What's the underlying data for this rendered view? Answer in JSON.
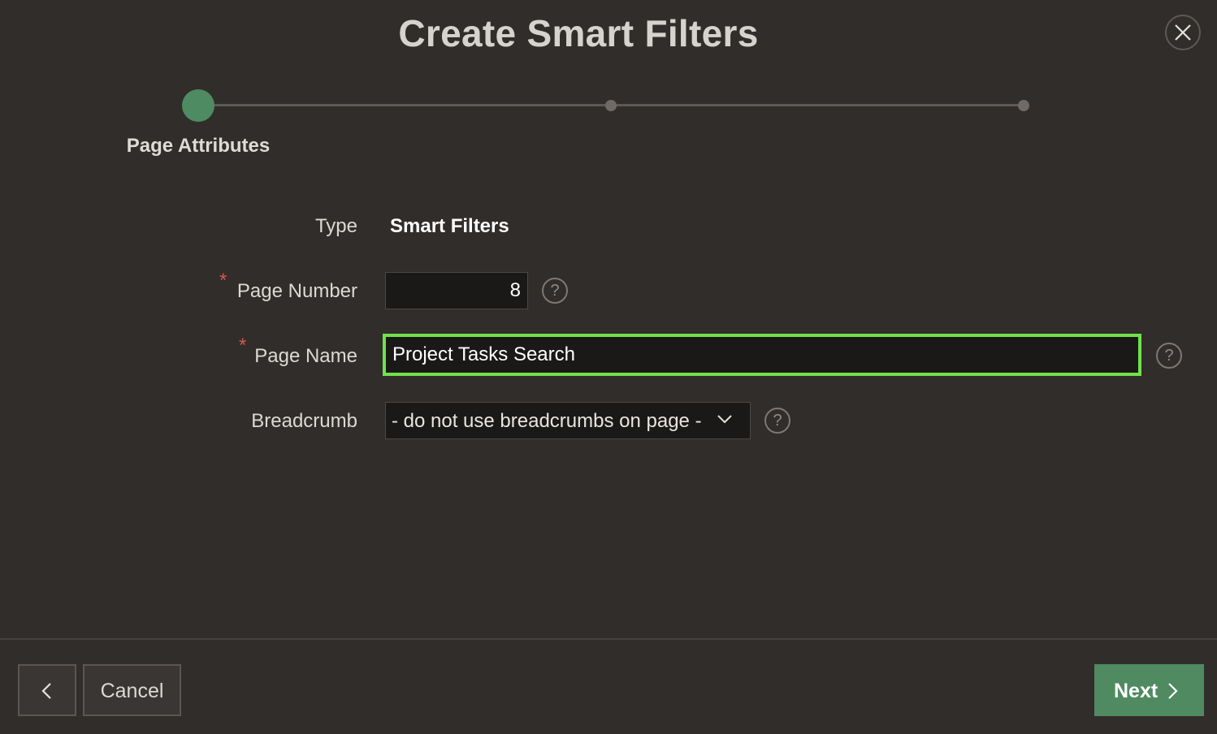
{
  "dialog": {
    "title": "Create Smart Filters"
  },
  "wizard": {
    "steps": [
      {
        "label": "Page Attributes",
        "state": "active"
      },
      {
        "label": "",
        "state": "inactive"
      },
      {
        "label": "",
        "state": "inactive"
      }
    ]
  },
  "form": {
    "type": {
      "label": "Type",
      "value": "Smart Filters"
    },
    "page_number": {
      "label": "Page Number",
      "value": "8",
      "required_mark": "*"
    },
    "page_name": {
      "label": "Page Name",
      "value": "Project Tasks Search",
      "required_mark": "*"
    },
    "breadcrumb": {
      "label": "Breadcrumb",
      "selected": "- do not use breadcrumbs on page -"
    },
    "help_glyph": "?"
  },
  "footer": {
    "cancel_label": "Cancel",
    "next_label": "Next"
  },
  "icons": {
    "close": "close-icon",
    "help": "help-icon",
    "chevron_down": "chevron-down-icon",
    "chevron_left": "chevron-left-icon",
    "chevron_right": "chevron-right-icon"
  },
  "colors": {
    "background": "#312d2a",
    "accent_green": "#4f8a60",
    "focus_border": "#6fe24a",
    "required": "#d2584a"
  }
}
